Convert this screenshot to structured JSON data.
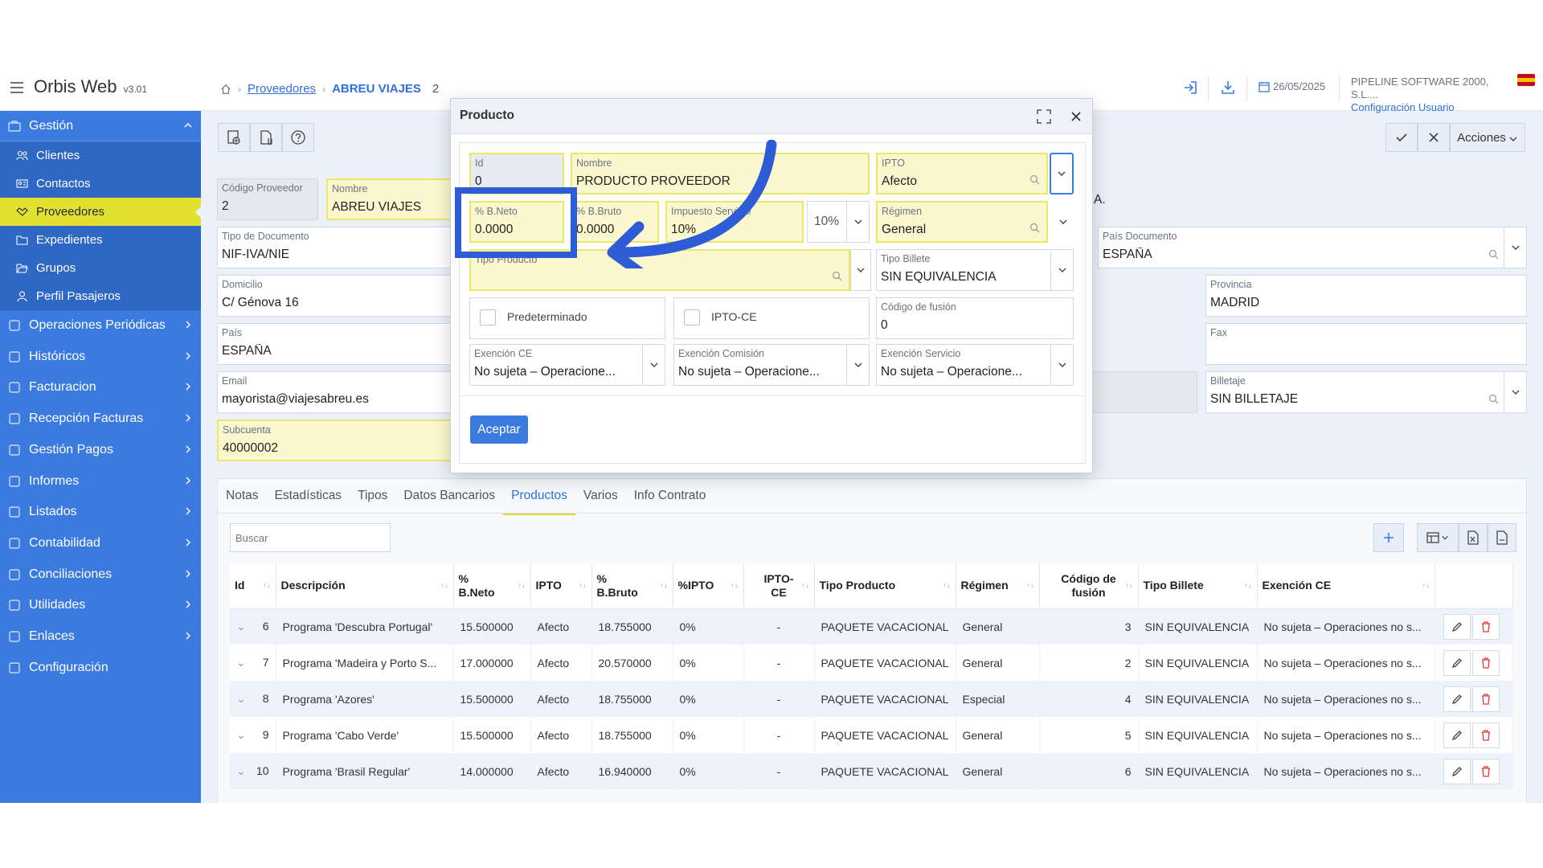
{
  "app": {
    "name": "Orbis Web",
    "version": "v3.01"
  },
  "breadcrumb": {
    "level1": "Proveedores",
    "level2": "ABREU VIAJES",
    "id": "2"
  },
  "topbar": {
    "date": "26/05/2025",
    "company": "PIPELINE SOFTWARE 2000, S.L....",
    "config": "Configuración Usuario",
    "flag_colors": [
      "#c60b1e",
      "#ffc400",
      "#c60b1e"
    ]
  },
  "sidebar": {
    "gestion": "Gestión",
    "sub": [
      "Clientes",
      "Contactos",
      "Proveedores",
      "Expedientes",
      "Grupos",
      "Perfil Pasajeros"
    ],
    "items": [
      "Operaciones Periódicas",
      "Históricos",
      "Facturacion",
      "Recepción Facturas",
      "Gestión Pagos",
      "Informes",
      "Listados",
      "Contabilidad",
      "Conciliaciones",
      "Utilidades",
      "Enlaces",
      "Configuración"
    ]
  },
  "toolbar": {
    "acciones": "Acciones"
  },
  "form": {
    "codigo_label": "Código Proveedor",
    "codigo_value": "2",
    "nombre_label": "Nombre",
    "nombre_value": "ABREU VIAJES",
    "razon_partial": "A.",
    "tipo_doc_label": "Tipo de Documento",
    "tipo_doc_value": "NIF-IVA/NIE",
    "pais_doc_label": "País Documento",
    "pais_doc_value": "ESPAÑA",
    "domicilio_label": "Domicilio",
    "domicilio_value": "C/ Génova 16",
    "provincia_label": "Provincia",
    "provincia_value": "MADRID",
    "pais_label": "País",
    "pais_value": "ESPAÑA",
    "fax_label": "Fax",
    "fax_value": "",
    "email_label": "Email",
    "email_value": "mayorista@viajesabreu.es",
    "billetaje_label": "Billetaje",
    "billetaje_value": "SIN BILLETAJE",
    "subcuenta_label": "Subcuenta",
    "subcuenta_value": "40000002"
  },
  "tabs": [
    "Notas",
    "Estadísticas",
    "Tipos",
    "Datos Bancarios",
    "Productos",
    "Varios",
    "Info Contrato"
  ],
  "search_placeholder": "Buscar",
  "table": {
    "headers": [
      {
        "l1": "Id",
        "l2": ""
      },
      {
        "l1": "Descripción",
        "l2": ""
      },
      {
        "l1": "%",
        "l2": "B.Neto"
      },
      {
        "l1": "IPTO",
        "l2": ""
      },
      {
        "l1": "%",
        "l2": "B.Bruto"
      },
      {
        "l1": "%IPTO",
        "l2": ""
      },
      {
        "l1": "IPTO-",
        "l2": "CE"
      },
      {
        "l1": "Tipo Producto",
        "l2": ""
      },
      {
        "l1": "Régimen",
        "l2": ""
      },
      {
        "l1": "Código de",
        "l2": "fusión"
      },
      {
        "l1": "Tipo Billete",
        "l2": ""
      },
      {
        "l1": "Exención CE",
        "l2": ""
      }
    ],
    "rows": [
      {
        "id": "6",
        "desc": "Programa 'Descubra Portugal'",
        "neto": "15.500000",
        "ipto": "Afecto",
        "bruto": "18.755000",
        "pipto": "0%",
        "iptoce": "-",
        "tipo": "PAQUETE VACACIONAL",
        "regimen": "General",
        "fusion": "3",
        "billete": "SIN EQUIVALENCIA",
        "exencion": "No sujeta – Operaciones no s..."
      },
      {
        "id": "7",
        "desc": "Programa 'Madeira y Porto S...",
        "neto": "17.000000",
        "ipto": "Afecto",
        "bruto": "20.570000",
        "pipto": "0%",
        "iptoce": "-",
        "tipo": "PAQUETE VACACIONAL",
        "regimen": "General",
        "fusion": "2",
        "billete": "SIN EQUIVALENCIA",
        "exencion": "No sujeta – Operaciones no s..."
      },
      {
        "id": "8",
        "desc": "Programa 'Azores'",
        "neto": "15.500000",
        "ipto": "Afecto",
        "bruto": "18.755000",
        "pipto": "0%",
        "iptoce": "-",
        "tipo": "PAQUETE VACACIONAL",
        "regimen": "Especial",
        "fusion": "4",
        "billete": "SIN EQUIVALENCIA",
        "exencion": "No sujeta – Operaciones no s..."
      },
      {
        "id": "9",
        "desc": "Programa 'Cabo Verde'",
        "neto": "15.500000",
        "ipto": "Afecto",
        "bruto": "18.755000",
        "pipto": "0%",
        "iptoce": "-",
        "tipo": "PAQUETE VACACIONAL",
        "regimen": "General",
        "fusion": "5",
        "billete": "SIN EQUIVALENCIA",
        "exencion": "No sujeta – Operaciones no s..."
      },
      {
        "id": "10",
        "desc": "Programa 'Brasil Regular'",
        "neto": "14.000000",
        "ipto": "Afecto",
        "bruto": "16.940000",
        "pipto": "0%",
        "iptoce": "-",
        "tipo": "PAQUETE VACACIONAL",
        "regimen": "General",
        "fusion": "6",
        "billete": "SIN EQUIVALENCIA",
        "exencion": "No sujeta – Operaciones no s..."
      }
    ]
  },
  "modal": {
    "title": "Producto",
    "id_label": "Id",
    "id_value": "0",
    "nombre_label": "Nombre",
    "nombre_value": "PRODUCTO PROVEEDOR",
    "ipto_label": "IPTO",
    "ipto_value": "Afecto",
    "neto_label": "% B.Neto",
    "neto_value": "0.0000",
    "bruto_label": "% B.Bruto",
    "bruto_value": "0.0000",
    "imp_label": "Impuesto Servicio",
    "imp_value": "10%",
    "imp_select": "10%",
    "regimen_label": "Régimen",
    "regimen_value": "General",
    "tipo_producto_label": "Tipo Producto",
    "tipo_producto_value": "",
    "tipo_billete_label": "Tipo Billete",
    "tipo_billete_value": "SIN EQUIVALENCIA",
    "predeterminado": "Predeterminado",
    "iptoce": "IPTO-CE",
    "fusion_label": "Código de fusión",
    "fusion_value": "0",
    "exencion_ce_label": "Exención CE",
    "exencion_ce_value": "No sujeta – Operacione...",
    "exencion_com_label": "Exención Comisión",
    "exencion_com_value": "No sujeta – Operacione...",
    "exencion_serv_label": "Exención Servicio",
    "exencion_serv_value": "No sujeta – Operacione...",
    "accept": "Aceptar"
  },
  "annotation_color": "#2e5bd6"
}
